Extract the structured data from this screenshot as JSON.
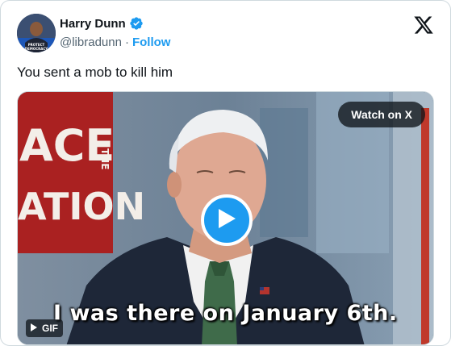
{
  "author": {
    "name": "Harry Dunn",
    "handle": "@libradunn",
    "separator": "·",
    "follow_label": "Follow",
    "avatar_icon": "avatar-photo",
    "verified_icon": "verified-badge-icon",
    "avatar_text_1": "PROTECT",
    "avatar_text_2": "DEMOCRACY"
  },
  "platform_icon": "x-logo-icon",
  "tweet": {
    "text": "You sent a mob to kill him"
  },
  "media": {
    "watch_label": "Watch on X",
    "caption": "I was there on January 6th.",
    "gif_label": "GIF",
    "backdrop_text_1": "ACE",
    "backdrop_text_2": "ATION",
    "backdrop_text_3": "THE",
    "play_icon": "play-icon"
  },
  "colors": {
    "accent": "#1d9bf0",
    "text": "#0f1419",
    "secondary": "#536471"
  }
}
